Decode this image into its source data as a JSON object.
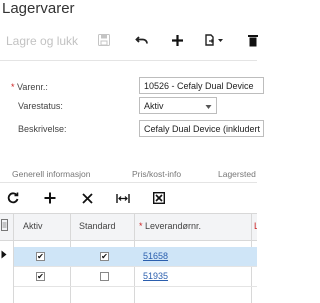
{
  "header": {
    "title": "Lagervarer",
    "save_close_label": "Lagre og lukk"
  },
  "toolbar": {
    "icons": [
      "save-icon",
      "undo-icon",
      "add-icon",
      "copy-paste-icon",
      "delete-icon"
    ]
  },
  "form": {
    "inventory_id_label": "Varenr.:",
    "inventory_id_value": "10526 - Cefaly Dual Device",
    "status_label": "Varestatus:",
    "status_value": "Aktiv",
    "description_label": "Beskrivelse:",
    "description_value": "Cefaly Dual Device (inkludert"
  },
  "tabs": [
    {
      "label": "Generell informasjon"
    },
    {
      "label": "Pris/kost-info"
    },
    {
      "label": "Lagersted"
    }
  ],
  "grid_toolbar": {
    "icons": [
      "refresh-icon",
      "add-row-icon",
      "delete-row-icon",
      "fit-columns-icon",
      "export-icon"
    ]
  },
  "grid": {
    "columns": [
      "Aktiv",
      "Standard",
      "Leverandørnr."
    ],
    "rows": [
      {
        "active": true,
        "default": true,
        "vendor": "51658",
        "selected": true
      },
      {
        "active": true,
        "default": false,
        "vendor": "51935",
        "selected": false
      }
    ]
  },
  "colors": {
    "selected_row": "#cfe5f7",
    "link": "#2b5fae",
    "required_marker": "#cc2222"
  }
}
